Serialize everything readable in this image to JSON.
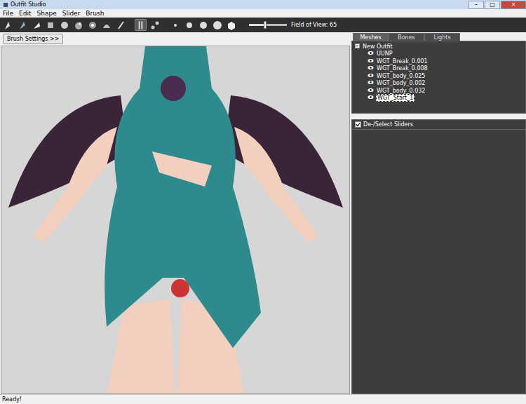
{
  "window": {
    "title": "Outfit Studio",
    "buttons": [
      "–",
      "□",
      "×"
    ]
  },
  "menu": [
    "File",
    "Edit",
    "Shape",
    "Slider",
    "Brush"
  ],
  "toolbar": {
    "tools": [
      {
        "selected": false
      },
      {
        "selected": false
      },
      {
        "selected": false
      },
      {
        "selected": false
      },
      {
        "selected": false
      },
      {
        "selected": false
      },
      {
        "selected": false
      },
      {
        "selected": false
      },
      {
        "selected": false
      },
      {
        "selected": true
      },
      {
        "selected": false
      },
      {
        "selected": false
      },
      {
        "selected": false
      },
      {
        "selected": false
      },
      {
        "selected": false
      },
      {
        "selected": false
      }
    ],
    "fov": {
      "label": "Field of View: 65",
      "level": 0.42
    }
  },
  "brush_button": "Brush Settings >>",
  "tabs": [
    {
      "label": "Meshes",
      "selected": true
    },
    {
      "label": "Bones",
      "selected": false
    },
    {
      "label": "Lights",
      "selected": false
    }
  ],
  "tree": {
    "root": {
      "label": "New Outfit",
      "expanded": true
    },
    "items": [
      {
        "label": "UUNP",
        "visible": true,
        "selected": false
      },
      {
        "label": "WGT_Break_0.001",
        "visible": true,
        "selected": false
      },
      {
        "label": "WGT_Break_0.008",
        "visible": true,
        "selected": false
      },
      {
        "label": "WGT_body_0.025",
        "visible": true,
        "selected": false
      },
      {
        "label": "WGT_body_0.002",
        "visible": true,
        "selected": false
      },
      {
        "label": "WGT_body_0.032",
        "visible": true,
        "selected": false
      },
      {
        "label": "WGT_Start_1",
        "visible": true,
        "selected": true
      }
    ]
  },
  "sliders": {
    "label": "De-/Select Sliders",
    "checked": true
  },
  "status_bar": "Ready!"
}
